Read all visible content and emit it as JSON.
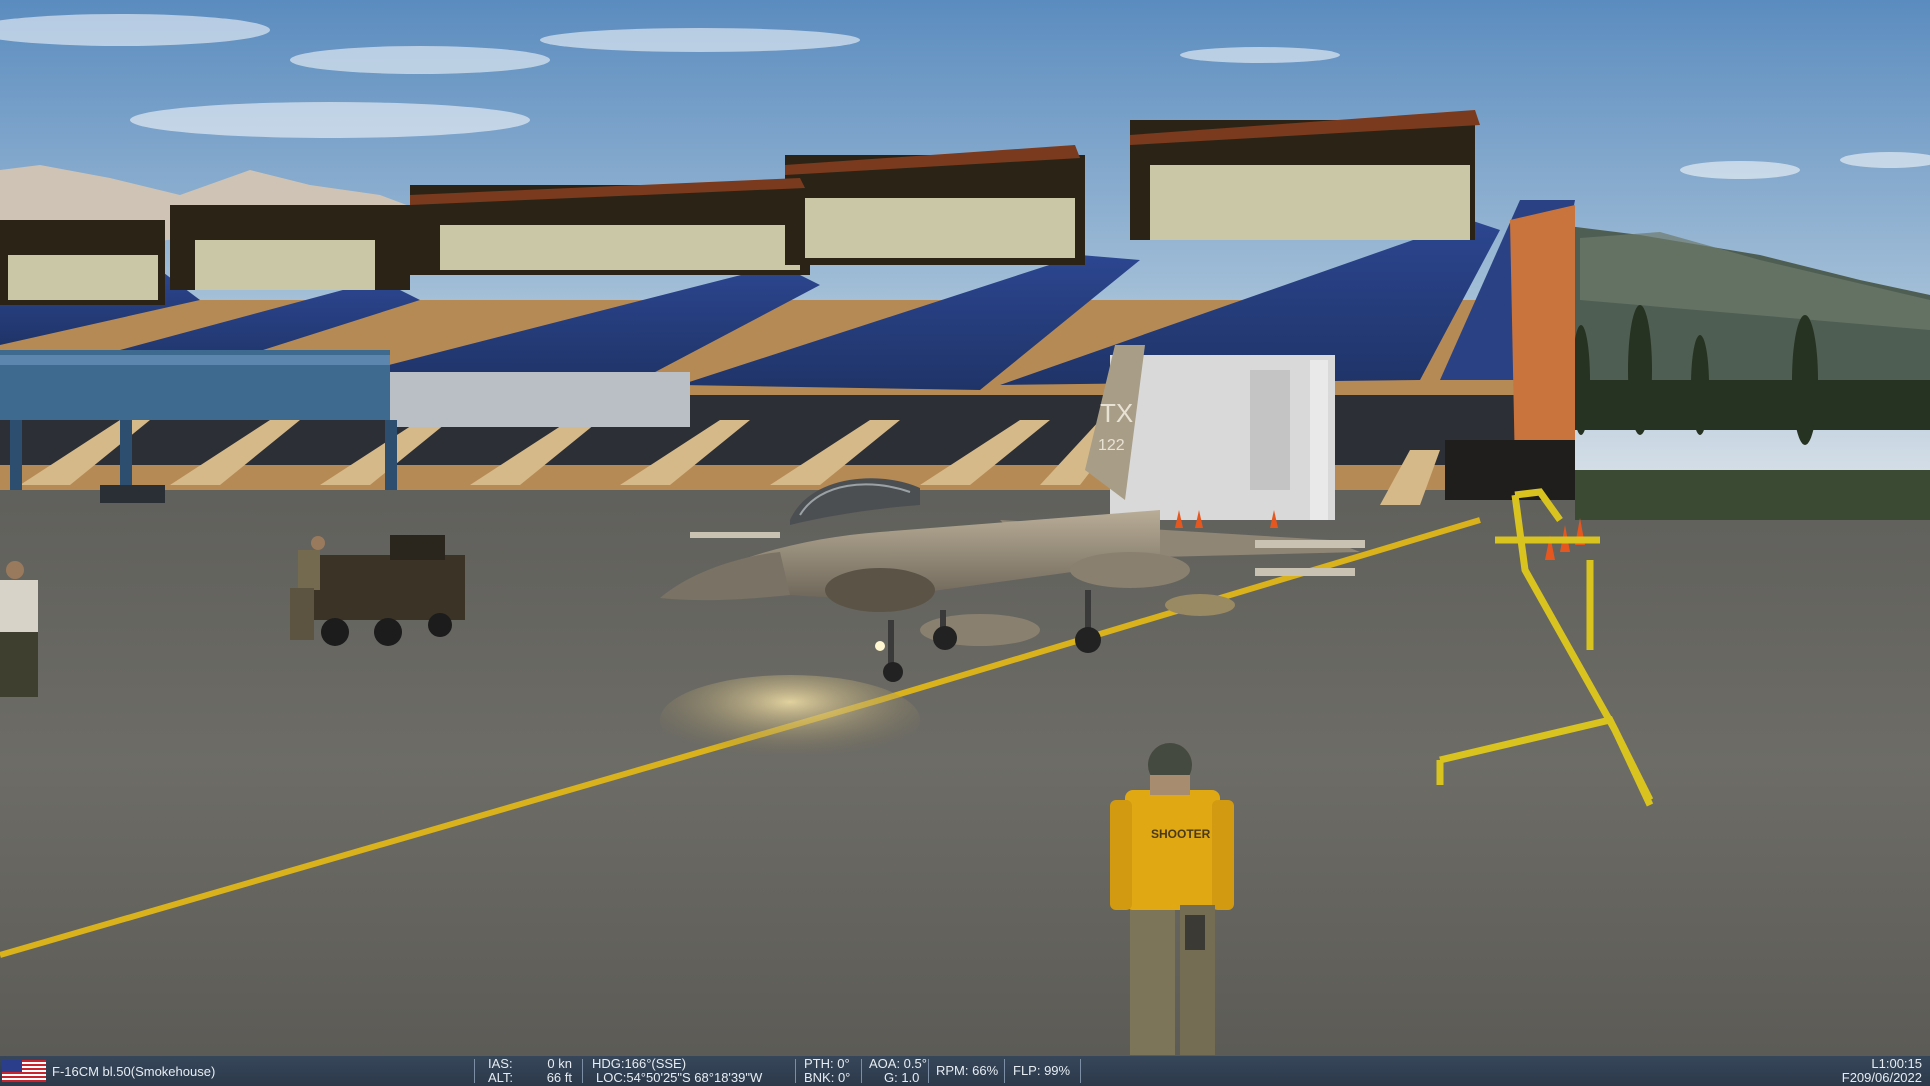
{
  "hud": {
    "aircraft": "F-16CM bl.50(Smokehouse)",
    "flag_icon": "us-flag-icon",
    "ias_label": "IAS:",
    "ias_value": "0 kn",
    "alt_label": "ALT:",
    "alt_value": "66 ft",
    "hdg": "HDG:166°(SSE)",
    "loc": "LOC:54°50'25\"S 68°18'39\"W",
    "pth": "PTH: 0°",
    "bnk": "BNK: 0°",
    "aoa": "AOA: 0.5°",
    "g": "G: 1.0",
    "rpm": "RPM: 66%",
    "flp": "FLP: 99%",
    "time": "L1:00:15",
    "date": "F209/06/2022"
  },
  "scene": {
    "tail_code": "TX",
    "tail_number": "122",
    "vest_text": "SHOOTER",
    "colors": {
      "sky_top": "#5f8fbf",
      "sky_horizon": "#c9d8e4",
      "tarmac": "#6b6b66",
      "roof_blue": "#283f7e",
      "taxi_line": "#d8b11d",
      "vest_yellow": "#e0a813",
      "ladder_yellow": "#d9c31f"
    }
  }
}
